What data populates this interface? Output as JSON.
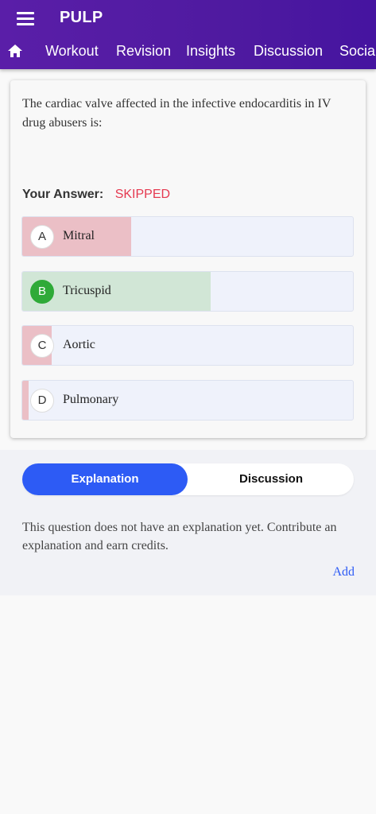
{
  "app": {
    "title": "PULP"
  },
  "nav": {
    "tabs": [
      {
        "label": "Workout"
      },
      {
        "label": "Revision"
      },
      {
        "label": "Insights"
      },
      {
        "label": "Discussion"
      },
      {
        "label": "Social"
      }
    ]
  },
  "question": {
    "text": "The cardiac valve affected in the infective endocarditis in IV drug abusers is:",
    "answer_label": "Your Answer:",
    "answer_value": "SKIPPED"
  },
  "options": [
    {
      "letter": "A",
      "text": "Mitral",
      "response_fraction": 0.33,
      "status": "incorrect"
    },
    {
      "letter": "B",
      "text": "Tricuspid",
      "response_fraction": 0.57,
      "status": "correct"
    },
    {
      "letter": "C",
      "text": "Aortic",
      "response_fraction": 0.09,
      "status": "incorrect"
    },
    {
      "letter": "D",
      "text": "Pulmonary",
      "response_fraction": 0.02,
      "status": "incorrect"
    }
  ],
  "explanation": {
    "tab_explanation": "Explanation",
    "tab_discussion": "Discussion",
    "text": "This question does not have an explanation yet. Contribute an explanation and earn credits.",
    "add_label": "Add"
  },
  "colors": {
    "header": "#5a1ea8",
    "correct_fill": "#d1e6d6",
    "incorrect_fill": "#ebbfc6",
    "accent": "#2d5bf5",
    "skipped": "#e53950"
  }
}
